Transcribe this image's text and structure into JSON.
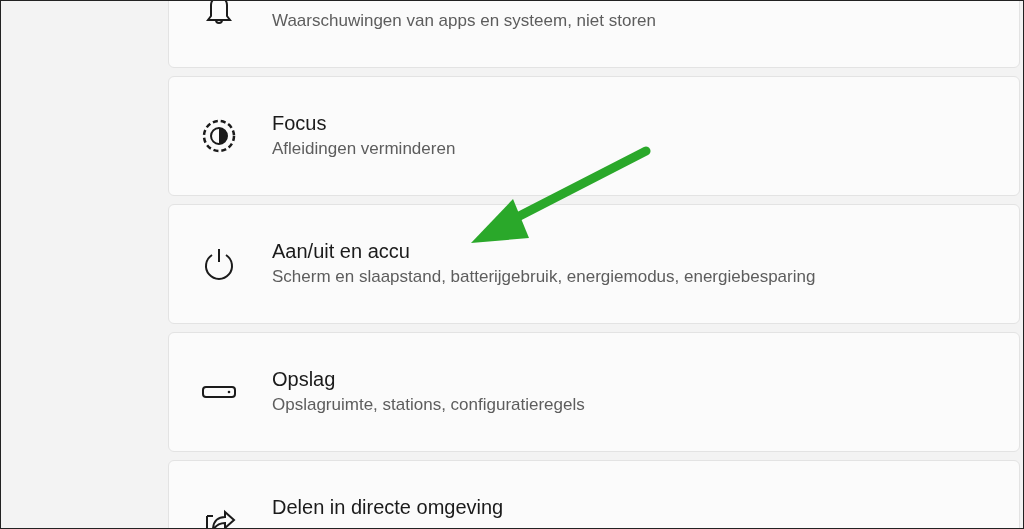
{
  "settings": [
    {
      "kind": "bell",
      "subtitle": "Waarschuwingen van apps en systeem, niet storen"
    },
    {
      "kind": "focus",
      "title": "Focus",
      "subtitle": "Afleidingen verminderen"
    },
    {
      "kind": "power",
      "title": "Aan/uit en accu",
      "subtitle": "Scherm en slaapstand, batterijgebruik, energiemodus, energiebesparing"
    },
    {
      "kind": "storage",
      "title": "Opslag",
      "subtitle": "Opslagruimte, stations, configuratieregels"
    },
    {
      "kind": "share",
      "title": "Delen in directe omgeving"
    }
  ]
}
